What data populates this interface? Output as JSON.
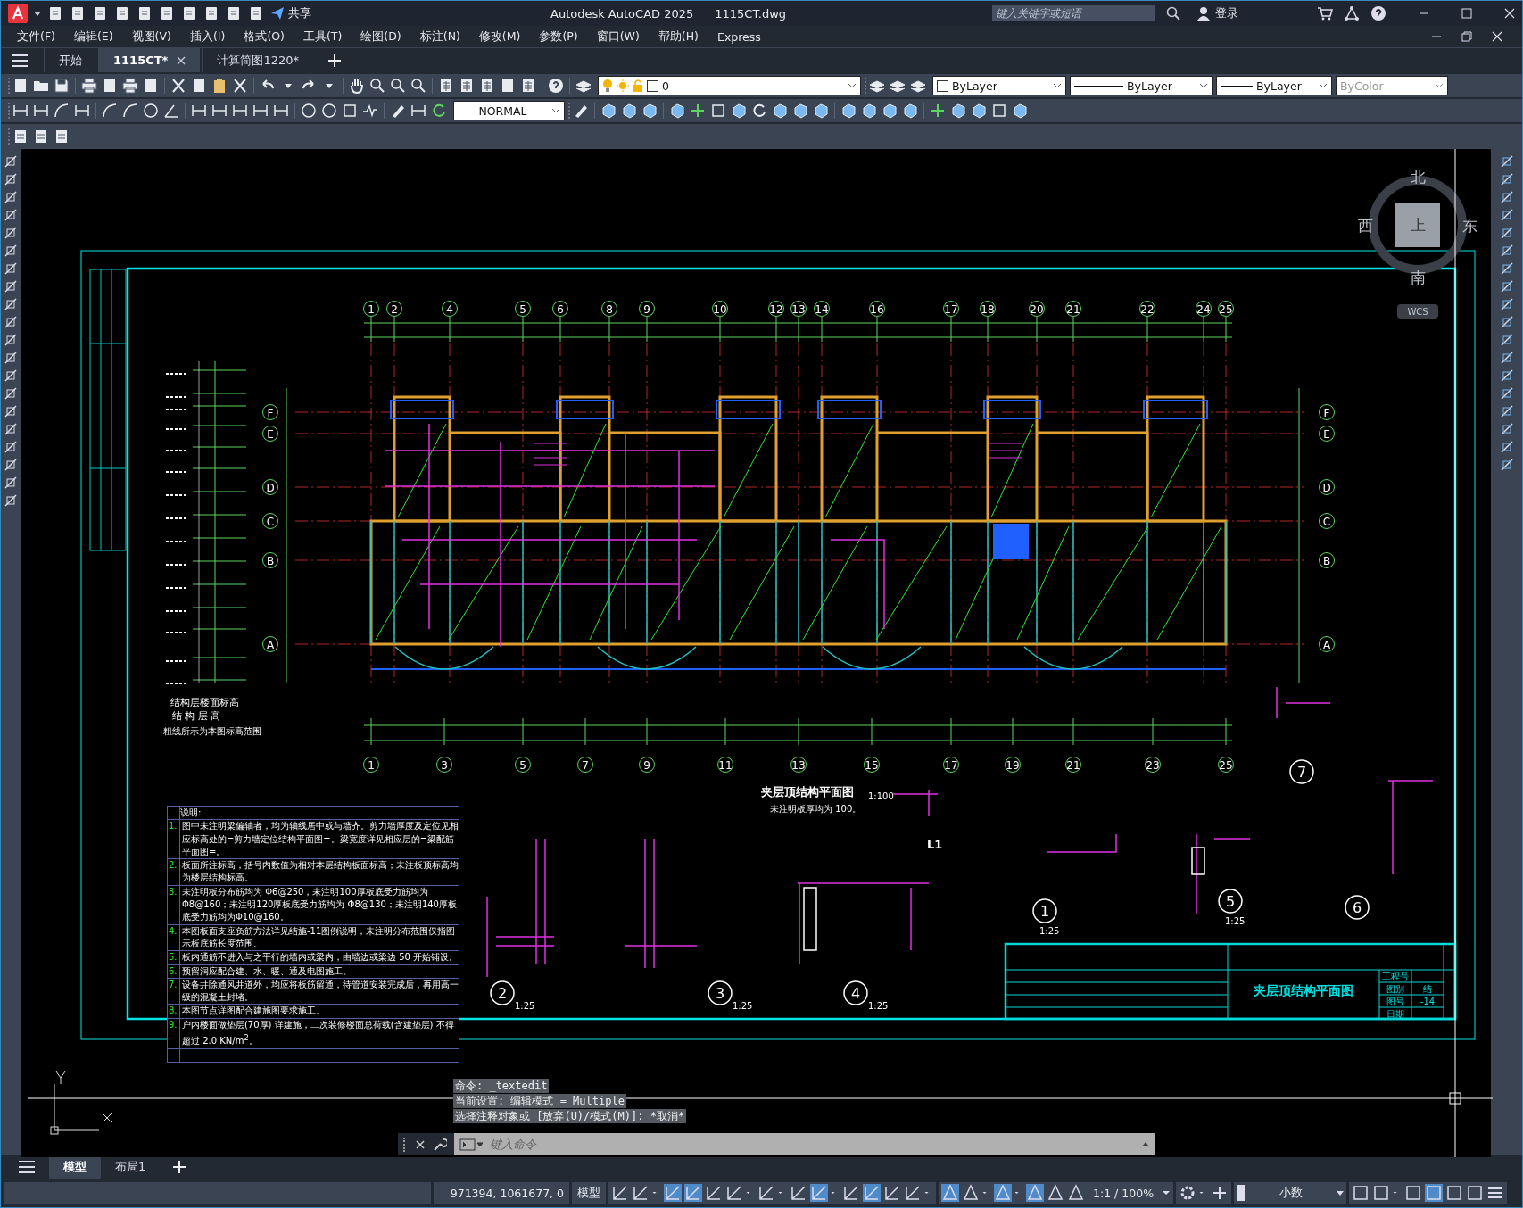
{
  "title_bar": {
    "title": "Autodesk AutoCAD 2025",
    "file": "1115CT.dwg",
    "share": "共享",
    "search_placeholder": "键入关键字或短语",
    "sign_in": "登录"
  },
  "menu": [
    "文件(F)",
    "编辑(E)",
    "视图(V)",
    "插入(I)",
    "格式(O)",
    "工具(T)",
    "绘图(D)",
    "标注(N)",
    "修改(M)",
    "参数(P)",
    "窗口(W)",
    "帮助(H)",
    "Express"
  ],
  "doc_tabs": [
    {
      "label": "开始",
      "selected": false
    },
    {
      "label": "1115CT*",
      "selected": true
    },
    {
      "label": "计算简图1220*",
      "selected": false
    }
  ],
  "toolbar": {
    "layer": "0",
    "color_setting": "ByLayer",
    "linetype": "ByLayer",
    "lineweight": "ByLayer",
    "plot_style": {
      "value": "ByColor",
      "disabled": true
    },
    "dim_style": "NORMAL"
  },
  "drawing": {
    "compass": {
      "north": "北",
      "west": "西",
      "east": "东",
      "south": "南",
      "top": "上",
      "ucs": "WCS"
    },
    "plan": {
      "title": "夹层顶结构平面图",
      "scale": "1:100",
      "note": "未注明板厚均为 100。",
      "top_axes": [
        "1",
        "2",
        "4",
        "5",
        "6",
        "8",
        "9",
        "10",
        "12",
        "13",
        "14",
        "16",
        "17",
        "18",
        "20",
        "21",
        "22",
        "24",
        "25"
      ],
      "bottom_axes": [
        "1",
        "3",
        "5",
        "7",
        "9",
        "11",
        "13",
        "15",
        "17",
        "19",
        "21",
        "23",
        "25"
      ],
      "left_axes": [
        "F",
        "E",
        "D",
        "C",
        "B",
        "A"
      ],
      "right_axes": [
        "F",
        "E",
        "D",
        "C",
        "B",
        "A"
      ]
    },
    "legend": {
      "title": "结构层楼面标高",
      "subtitle": "结 构 层 高",
      "note": "粗线所示为本图标高范围"
    },
    "notes": {
      "heading": "说明:",
      "numbers": [
        "1.",
        "2.",
        "3.",
        "4.",
        "5.",
        "6.",
        "7.",
        "8.",
        "9."
      ],
      "items": [
        "图中未注明梁偏轴者，均为轴线居中或与墙齐。剪力墙厚度及定位见相应标高处的=剪力墙定位结构平面图=。梁宽度详见相应层的=梁配筋平面图=。",
        "板面所注标高，括号内数值为相对本层结构板面标高；未注板顶标高均为楼层结构标高。",
        "未注明板分布筋均为 Φ6@250，未注明100厚板底受力筋均为 Φ8@160；未注明120厚板底受力筋均为 Φ8@130；未注明140厚板底受力筋均为Φ10@160。",
        "本图板面支座负筋方法详见结施-11图例说明，未注明分布范围仅指图示板底筋长度范围。",
        "板内通筋不进入与之平行的墙内或梁内，由墙边或梁边 50 开始铺设。",
        "预留洞应配合建、水、暖、通及电图施工。",
        "设备井除通风井道外，均应将板筋留通，待管道安装完成后，再用高一级的混凝土封堵。",
        "本图节点详图配合建施图要求施工。",
        "户内楼面做垫层(70厚) 详建施，二次装修楼面总荷载(含建垫层) 不得超过 2.0 KN/m$^{2}$。"
      ]
    },
    "section_label": "L1",
    "details": [
      {
        "number": "1",
        "scale": "1:25"
      },
      {
        "number": "2",
        "scale": "1:25"
      },
      {
        "number": "3",
        "scale": "1:25"
      },
      {
        "number": "4",
        "scale": "1:25"
      },
      {
        "number": "5",
        "scale": "1:25"
      },
      {
        "number": "6"
      },
      {
        "number": "7"
      }
    ],
    "title_block": {
      "title": "夹层顶结构平面图",
      "rows": [
        {
          "label": "工程号"
        },
        {
          "label": "图别",
          "value": "结"
        },
        {
          "label": "图号",
          "value": "-14"
        },
        {
          "label": "日期"
        }
      ]
    }
  },
  "command": {
    "history": [
      "命令: _textedit",
      "当前设置: 编辑模式 = Multiple",
      "选择注释对象或 [放弃(U)/模式(M)]: *取消*"
    ],
    "placeholder": "键入命令"
  },
  "layout_tabs": [
    {
      "label": "模型",
      "selected": true
    },
    {
      "label": "布局1",
      "selected": false
    }
  ],
  "status_bar": {
    "coordinates": "971394, 1061677, 0",
    "space": "模型",
    "scale": "1:1 / 100%",
    "units": "小数"
  }
}
